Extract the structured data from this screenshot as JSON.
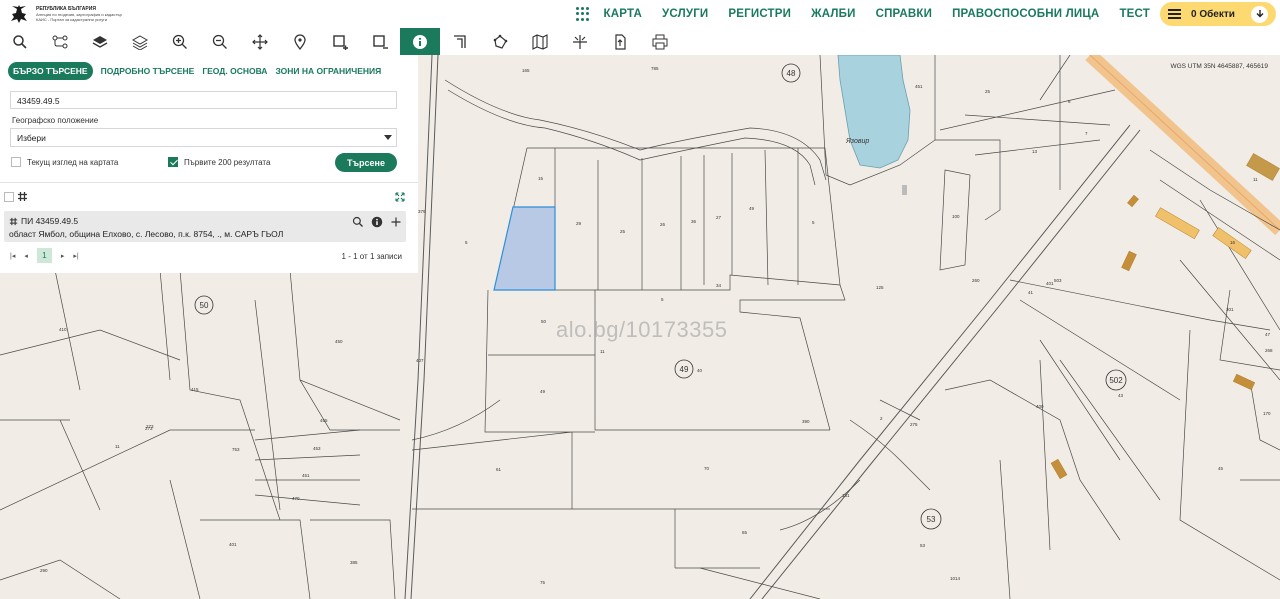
{
  "header": {
    "logo_line1": "РЕПУБЛИКА БЪЛГАРИЯ",
    "logo_line2": "Агенция по геодезия, картография и кадастър",
    "logo_line3": "КАИС - Портал за кадастрални услуги",
    "nav": [
      "КАРТА",
      "УСЛУГИ",
      "РЕГИСТРИ",
      "ЖАЛБИ",
      "СПРАВКИ",
      "ПРАВОСПОСОБНИ ЛИЦА",
      "ТЕСТ"
    ],
    "objects_label": "0 Обекти"
  },
  "toolbar": {
    "icons": [
      "search-icon",
      "route-icon",
      "layers-icon",
      "layers-outline-icon",
      "zoom-in-icon",
      "zoom-out-icon",
      "pan-icon",
      "location-pin-icon",
      "select-area-add-icon",
      "select-area-remove-icon",
      "info-icon",
      "measure-angle-icon",
      "measure-area-icon",
      "map-icon",
      "coordinates-icon",
      "export-icon",
      "print-icon"
    ],
    "active_icon": "info-icon",
    "accent": "#1b7a5b"
  },
  "panel": {
    "tabs": [
      "БЪРЗО ТЪРСЕНЕ",
      "ПОДРОБНО ТЪРСЕНЕ",
      "ГЕОД. ОСНОВА",
      "ЗОНИ НА ОГРАНИЧЕНИЯ"
    ],
    "active_tab": "БЪРЗО ТЪРСЕНЕ",
    "search_value": "43459.49.5",
    "geo_label": "Географско положение",
    "geo_select": "Избери",
    "current_view_label": "Текущ изглед на картата",
    "current_view_checked": false,
    "first200_label": "Първите 200 резултата",
    "first200_checked": true,
    "search_button": "Търсене",
    "result": {
      "id": "ПИ 43459.49.5",
      "address": "област Ямбол, община Елхово, с. Лесово, п.к. 8754, ., м. САРЪ ГЬОЛ"
    },
    "pager": {
      "current_page": "1",
      "info": "1 - 1 от 1 записи"
    }
  },
  "map": {
    "coords_text": "WGS UTM 35N 4645887, 465619",
    "lake_label": "Язовир",
    "watermark": "alo.bg/10173355",
    "region_numbers": [
      "48",
      "50",
      "49",
      "502",
      "53"
    ],
    "parcel_numbers": [
      "785",
      "165",
      "451",
      "25",
      "6",
      "7",
      "13",
      "15",
      "29",
      "25",
      "26",
      "36",
      "27",
      "49",
      "5",
      "11",
      "16",
      "100",
      "125",
      "260",
      "41",
      "50",
      "49",
      "40",
      "11",
      "503",
      "5",
      "34",
      "2",
      "273",
      "5",
      "61",
      "70",
      "65",
      "75",
      "131",
      "53",
      "1014",
      "410",
      "450",
      "415",
      "11",
      "273",
      "753",
      "455",
      "453",
      "451",
      "470",
      "401",
      "290",
      "385",
      "407",
      "379",
      "390",
      "400",
      "401",
      "43",
      "45",
      "275",
      "47",
      "301",
      "170",
      "268"
    ],
    "highlight_color": "#b8c9e6",
    "lake_color": "#a9d2df"
  }
}
